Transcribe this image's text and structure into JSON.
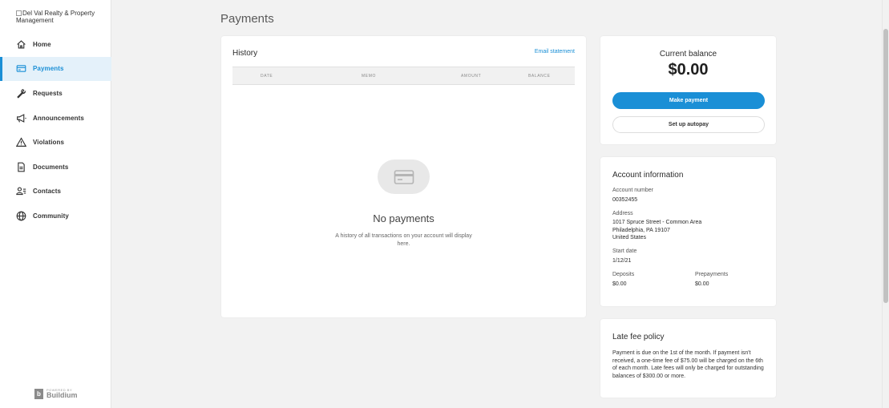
{
  "sidebar": {
    "logo_alt": "Del Val Realty & Property Management",
    "items": [
      {
        "label": "Home",
        "icon": "home-icon"
      },
      {
        "label": "Payments",
        "icon": "card-icon"
      },
      {
        "label": "Requests",
        "icon": "wrench-icon"
      },
      {
        "label": "Announcements",
        "icon": "megaphone-icon"
      },
      {
        "label": "Violations",
        "icon": "warning-icon"
      },
      {
        "label": "Documents",
        "icon": "document-icon"
      },
      {
        "label": "Contacts",
        "icon": "contacts-icon"
      },
      {
        "label": "Community",
        "icon": "globe-icon"
      }
    ],
    "active_index": 1,
    "powered_small": "POWERED BY",
    "powered_brand": "Buildium"
  },
  "page": {
    "title": "Payments"
  },
  "history": {
    "title": "History",
    "email_link": "Email statement",
    "columns": [
      "DATE",
      "MEMO",
      "AMOUNT",
      "BALANCE"
    ],
    "empty_title": "No payments",
    "empty_desc": "A history of all transactions on your account will display here."
  },
  "balance": {
    "label": "Current balance",
    "amount": "$0.00",
    "make_payment": "Make payment",
    "autopay": "Set up autopay"
  },
  "account": {
    "title": "Account information",
    "account_number_label": "Account number",
    "account_number": "00352455",
    "address_label": "Address",
    "address_line1": "1017 Spruce Street - Common Area",
    "address_line2": "Philadelphia, PA 19107",
    "address_line3": "United States",
    "start_date_label": "Start date",
    "start_date": "1/12/21",
    "deposits_label": "Deposits",
    "deposits": "$0.00",
    "prepayments_label": "Prepayments",
    "prepayments": "$0.00"
  },
  "late_fee": {
    "title": "Late fee policy",
    "text": "Payment is due on the 1st of the month. If payment isn't received, a one-time fee of $75.00 will be charged on the 6th of each month. Late fees will only be charged for outstanding balances of $300.00 or more."
  },
  "colors": {
    "accent": "#1a8fd6",
    "active_bg": "#e4f1fa",
    "page_bg": "#f2f2f2"
  }
}
